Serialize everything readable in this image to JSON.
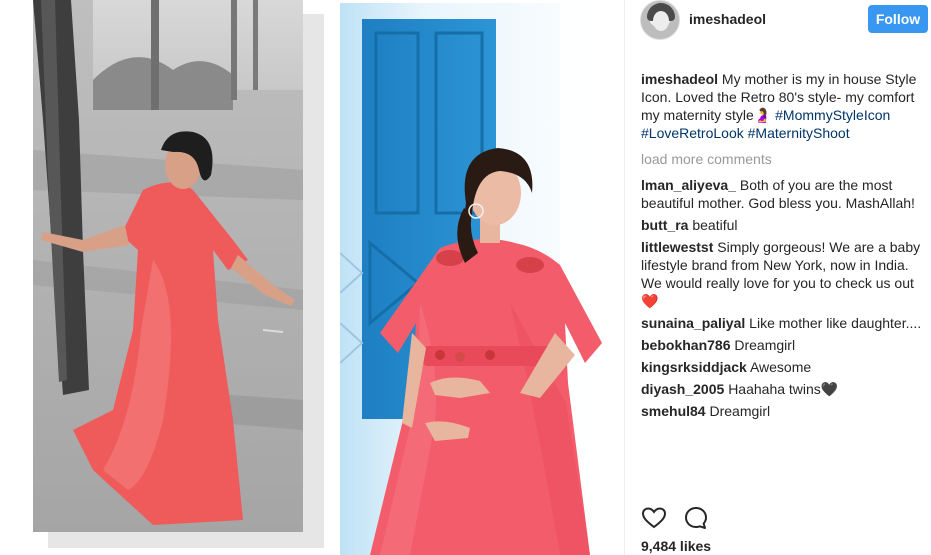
{
  "post": {
    "username": "imeshadeol",
    "follow_label": "Follow",
    "likes": "9,484 likes"
  },
  "caption": {
    "username": "imeshadeol",
    "text": "My mother is my in house Style Icon. Loved the Retro 80's style- my comfort my maternity style",
    "emoji": "🤰",
    "hashtags": [
      "#MommyStyleIcon",
      "#LoveRetroLook",
      "#MaternityShoot"
    ]
  },
  "load_more_label": "load more comments",
  "comments": [
    {
      "username": "lman_aliyeva_",
      "text": "Both of you are the most beautiful mother. God bless you. MashAllah!"
    },
    {
      "username": "butt_ra",
      "text": "beatiful"
    },
    {
      "username": "littlewestst",
      "text": "Simply gorgeous! We are a baby lifestyle brand from New York, now in India. We would really love for you to check us out",
      "emoji": "❤️"
    },
    {
      "username": "sunaina_paliyal",
      "text": "Like mother like daughter...."
    },
    {
      "username": "bebokhan786",
      "text": "Dreamgirl"
    },
    {
      "username": "kingsrksiddjack",
      "text": "Awesome"
    },
    {
      "username": "diyash_2005",
      "text": "Haahaha twins",
      "emoji": "🖤"
    },
    {
      "username": "smehul84",
      "text": "Dreamgirl"
    }
  ],
  "icons": [
    "heart-icon",
    "comment-icon"
  ],
  "colors": {
    "follow_bg": "#3897f0",
    "hashtag": "#003569",
    "muted": "#999999",
    "dress": "#ef5b5b",
    "door": "#1f86c9"
  }
}
